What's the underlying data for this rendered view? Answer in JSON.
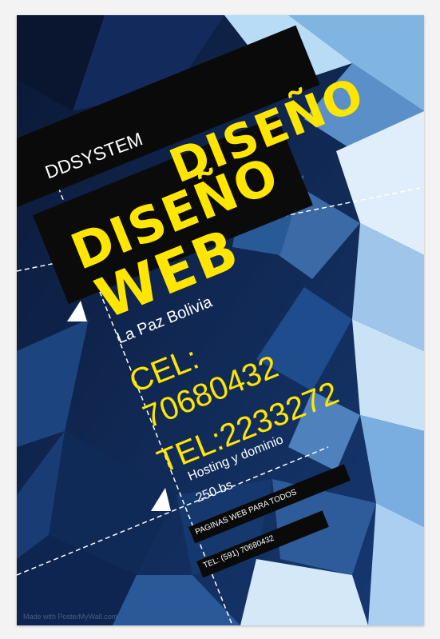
{
  "poster": {
    "brand": "DDSYSTEM",
    "headline_line1": "DISEÑO",
    "headline_line2": "DISEÑO",
    "headline_line3": "WEB",
    "location": "La Paz Bolivia",
    "cel": "CEL:",
    "cel_number": "70680432",
    "tel": "TEL:2233272",
    "hosting": "Hosting  y dominio",
    "price": "250 bs",
    "tagline": "PAGINAS WEB PARA TODOS",
    "tel_small": "TEL: (591) 70680432",
    "watermark": "Made with PosterMyWall.com"
  },
  "colors": {
    "accent_yellow": "#ffe600",
    "background_dark": "#0e1d3f",
    "band_black": "#0a0a0a"
  }
}
